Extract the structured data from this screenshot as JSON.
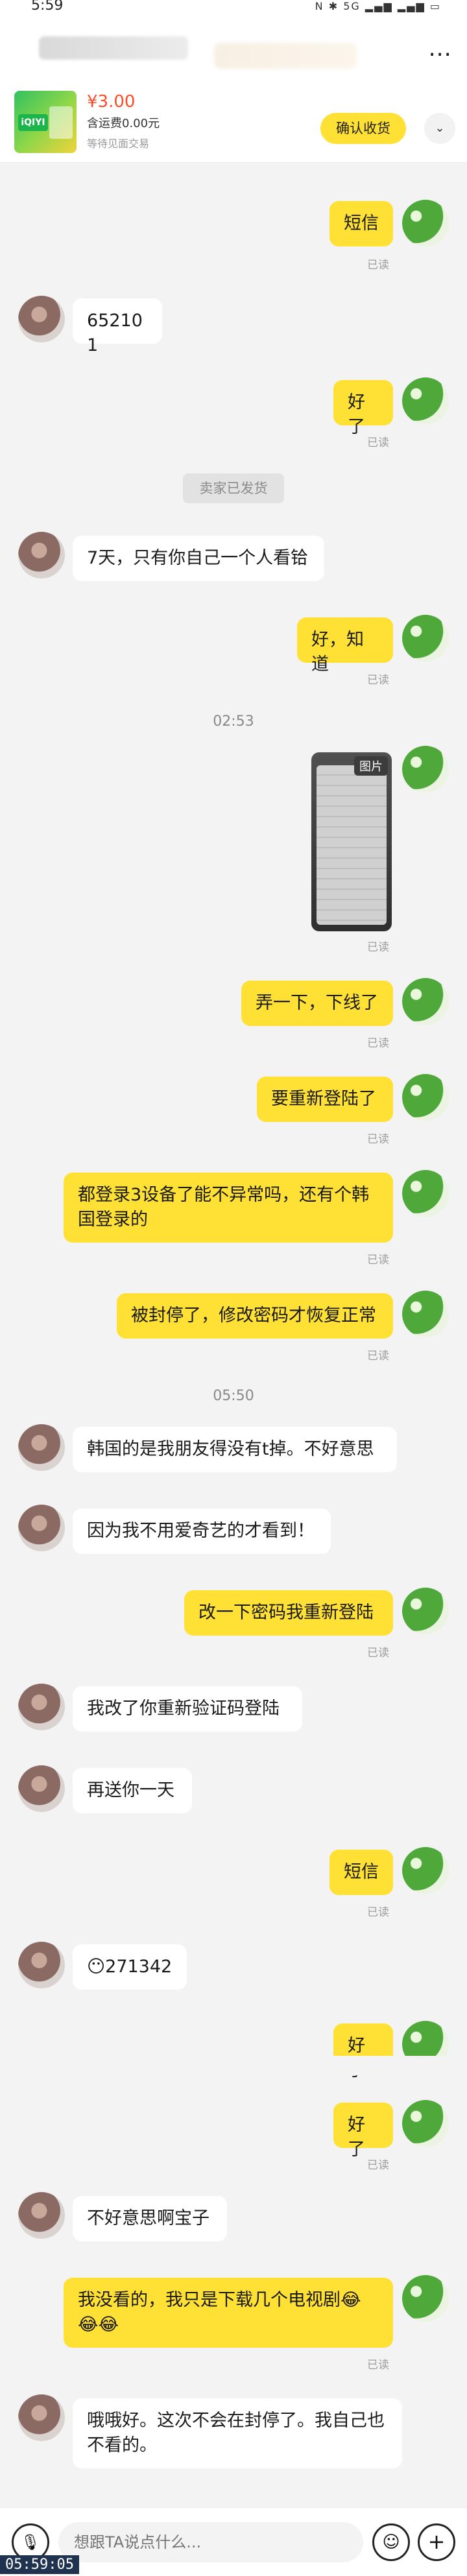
{
  "status_bar": {
    "time": "5:59",
    "icons": "N ✱ 5G ▂▄▆ ▂▄▆ ▭"
  },
  "header": {
    "more": "⋯"
  },
  "order": {
    "brand": "iQIYI",
    "price": "¥3.00",
    "shipping": "含运费0.00元",
    "status": "等待见面交易",
    "confirm_button": "确认收货",
    "expand_icon": "⌄"
  },
  "messages": [
    {
      "text": "短信"
    },
    {
      "text": "已读"
    },
    {
      "text": "652101"
    },
    {
      "text": "好了"
    },
    {
      "text": "已读"
    },
    {
      "text": "卖家已发货"
    },
    {
      "text": "7天，只有你自己一个人看铪"
    },
    {
      "text": "好，知道"
    },
    {
      "text": "已读"
    },
    {
      "text": "02:53"
    },
    {
      "text": "图片"
    },
    {
      "text": "已读"
    },
    {
      "text": "弄一下，下线了"
    },
    {
      "text": "已读"
    },
    {
      "text": "要重新登陆了"
    },
    {
      "text": "已读"
    },
    {
      "text": "都登录3设备了能不异常吗，还有个韩国登录的"
    },
    {
      "text": "已读"
    },
    {
      "text": "被封停了，修改密码才恢复正常"
    },
    {
      "text": "已读"
    },
    {
      "text": "05:50"
    },
    {
      "text": "韩国的是我朋友得没有t掉。不好意思"
    },
    {
      "text": "因为我不用爱奇艺的才看到！"
    },
    {
      "text": "改一下密码我重新登陆"
    },
    {
      "text": "已读"
    },
    {
      "text": "我改了你重新验证码登陆"
    },
    {
      "text": "再送你一天"
    },
    {
      "text": "短信"
    },
    {
      "text": "已读"
    },
    {
      "text": "😶271342"
    },
    {
      "text": "好了"
    },
    {
      "text": "好了"
    },
    {
      "text": "已读"
    },
    {
      "text": "不好意思啊宝子"
    },
    {
      "text": "我没看的，我只是下载几个电视剧😂😂😂"
    },
    {
      "text": "已读"
    },
    {
      "text": "哦哦好。这次不会在封停了。我自己也不看的。"
    }
  ],
  "input": {
    "placeholder": "想跟TA说点什么...",
    "voice_icon": "🎙",
    "emoji_icon": "☺",
    "plus_icon": "+"
  },
  "recording_time": "05:59:05"
}
